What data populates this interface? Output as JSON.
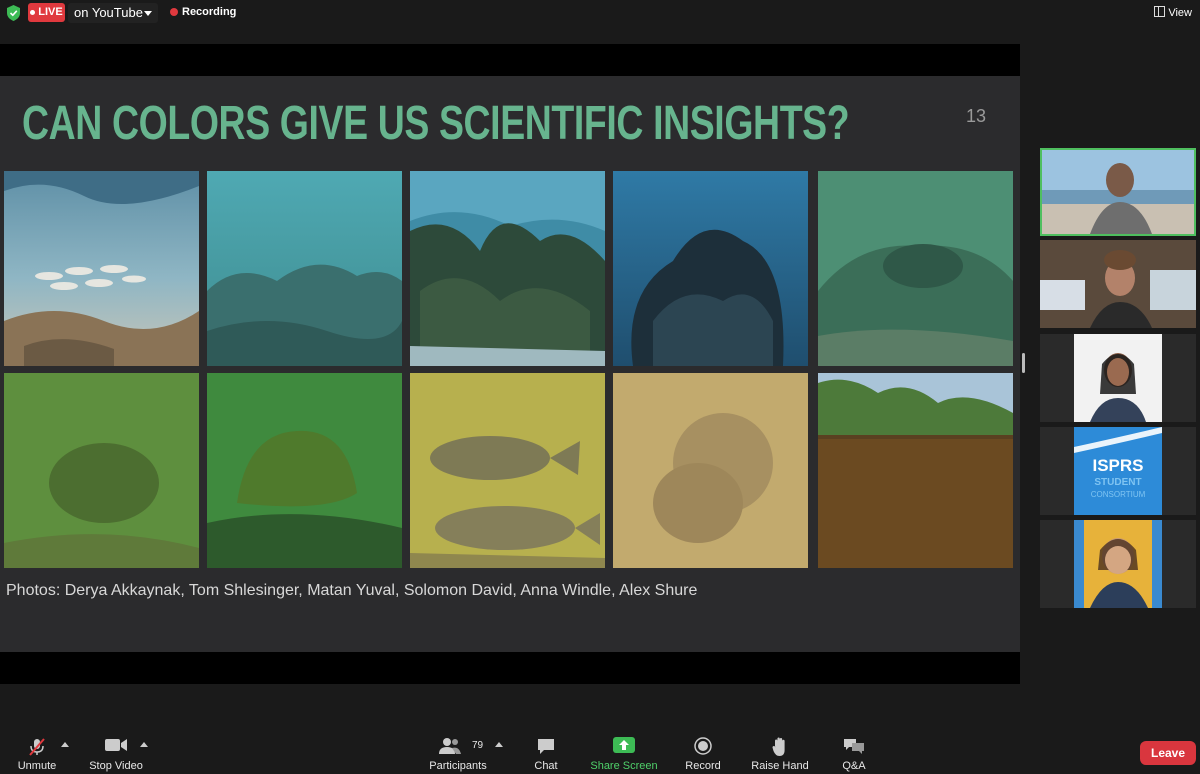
{
  "topbar": {
    "live_label": "LIVE",
    "stream_target": "on YouTube",
    "recording_label": "Recording",
    "view_label": "View"
  },
  "slide": {
    "title": "CAN COLORS GIVE US SCIENTIFIC INSIGHTS?",
    "page_number": "13",
    "credits": "Photos: Derya Akkaynak, Tom Shlesinger, Matan Yuval, Solomon David, Anna Windle, Alex Shure"
  },
  "participants_tiles": {
    "tile4_text": "ISPRS",
    "tile4_sub1": "STUDENT",
    "tile4_sub2": "CONSORTIUM"
  },
  "toolbar": {
    "unmute": "Unmute",
    "stop_video": "Stop Video",
    "participants": "Participants",
    "participants_count": "79",
    "chat": "Chat",
    "share_screen": "Share Screen",
    "record": "Record",
    "raise_hand": "Raise Hand",
    "qa": "Q&A",
    "leave": "Leave"
  },
  "colors": {
    "title_green": "#67b48e",
    "live_red": "#e0393e",
    "active_border": "#4fbf5f",
    "leave_red": "#d9363e"
  }
}
